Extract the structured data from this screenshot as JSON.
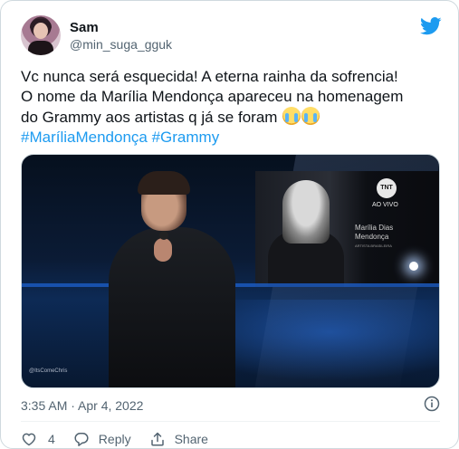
{
  "author": {
    "name": "Sam",
    "handle": "@min_suga_gguk"
  },
  "tweet": {
    "lines": [
      "Vc nunca será esquecida! A eterna rainha da sofrencia!",
      "O nome da Marília Mendonça apareceu na homenagem",
      "do Grammy aos artistas q já se foram"
    ],
    "hashtags": [
      "#MaríliaMendonça",
      "#Grammy"
    ],
    "emoji": "loudly-crying-face"
  },
  "media": {
    "screen_name_line1": "Marília Dias",
    "screen_name_line2": "Mendonça",
    "screen_caption": "ARTISTA BRASILEIRA",
    "broadcaster": "TNT",
    "broadcast_status": "AO VIVO",
    "watermark": "@ItsComeChris"
  },
  "meta": {
    "timestamp": "3:35 AM · Apr 4, 2022"
  },
  "actions": {
    "like_count": "4",
    "reply_label": "Reply",
    "share_label": "Share"
  },
  "colors": {
    "brand": "#1d9bf0",
    "text": "#0f1419",
    "muted": "#536471",
    "border": "#cfd9de"
  },
  "icons": {
    "brand": "twitter-bird-icon",
    "info": "info-icon",
    "like": "heart-icon",
    "reply": "reply-bubble-icon",
    "share": "share-icon"
  }
}
